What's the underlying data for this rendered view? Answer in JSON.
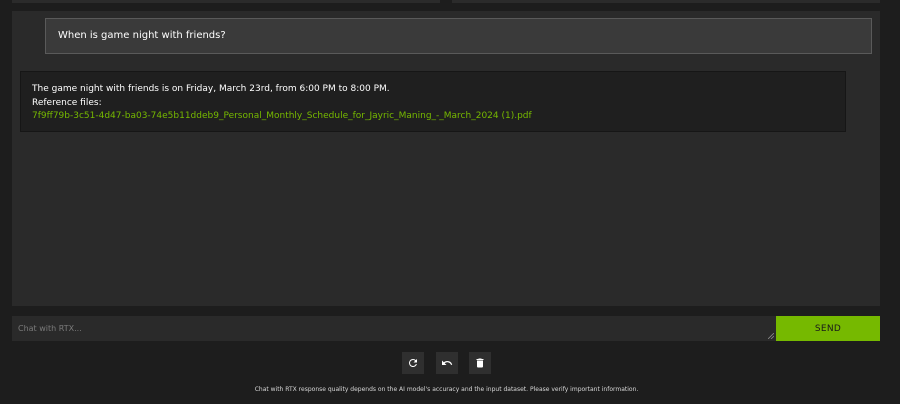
{
  "conversation": {
    "user_message": "When is game night with friends?",
    "bot_response": {
      "answer": "The game night with friends is on Friday, March 23rd, from 6:00 PM to 8:00 PM.",
      "reference_label": "Reference files:",
      "reference_file": "7f9ff79b-3c51-4d47-ba03-74e5b11ddeb9_Personal_Monthly_Schedule_for_Jayric_Maning_-_March_2024 (1).pdf"
    }
  },
  "input": {
    "placeholder": "Chat with RTX...",
    "value": ""
  },
  "send_button": {
    "label": "SEND"
  },
  "toolbar": {
    "buttons": [
      {
        "icon": "refresh-icon"
      },
      {
        "icon": "undo-icon"
      },
      {
        "icon": "trash-icon"
      }
    ]
  },
  "footer": {
    "disclaimer": "Chat with RTX response quality depends on the AI model's accuracy and the input dataset. Please verify important information."
  },
  "colors": {
    "accent": "#76b900",
    "background": "#1d1d1d",
    "panel": "#2a2a2a",
    "user_bubble": "#3a3a3a",
    "bot_bubble": "#1f1f1f"
  }
}
